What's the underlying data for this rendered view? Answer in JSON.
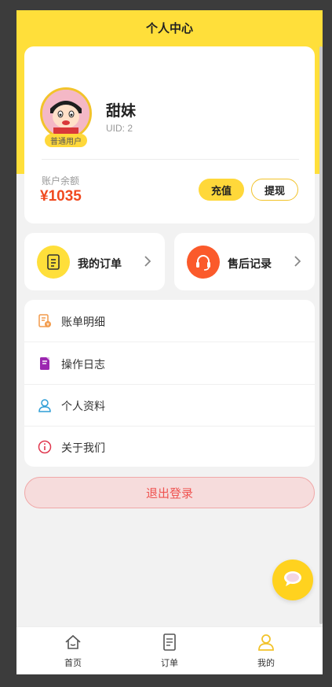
{
  "header": {
    "title": "个人中心"
  },
  "profile": {
    "name": "甜妹",
    "uid": "UID: 2",
    "level_badge": "普通用户",
    "balance_label": "账户余额",
    "balance_value": "¥1035",
    "recharge_label": "充值",
    "withdraw_label": "提现"
  },
  "quick_links": [
    {
      "label": "我的订单",
      "icon": "order-document-icon",
      "color": "#ffdf3a"
    },
    {
      "label": "售后记录",
      "icon": "headset-icon",
      "color": "#fb5a2b"
    }
  ],
  "menu": {
    "items": [
      {
        "label": "账单明细",
        "icon": "bill-icon",
        "color": "#f29a4a"
      },
      {
        "label": "操作日志",
        "icon": "log-book-icon",
        "color": "#9c27b0"
      },
      {
        "label": "个人资料",
        "icon": "user-profile-icon",
        "color": "#2f9ed6"
      },
      {
        "label": "关于我们",
        "icon": "info-icon",
        "color": "#e0374e"
      }
    ]
  },
  "logout_label": "退出登录",
  "tabbar": {
    "items": [
      {
        "label": "首页",
        "icon": "home-icon"
      },
      {
        "label": "订单",
        "icon": "order-list-icon"
      },
      {
        "label": "我的",
        "icon": "user-icon",
        "active": true
      }
    ]
  },
  "colors": {
    "brand": "#ffdf3a",
    "accent": "#f04a20",
    "danger": "#ef5350"
  }
}
